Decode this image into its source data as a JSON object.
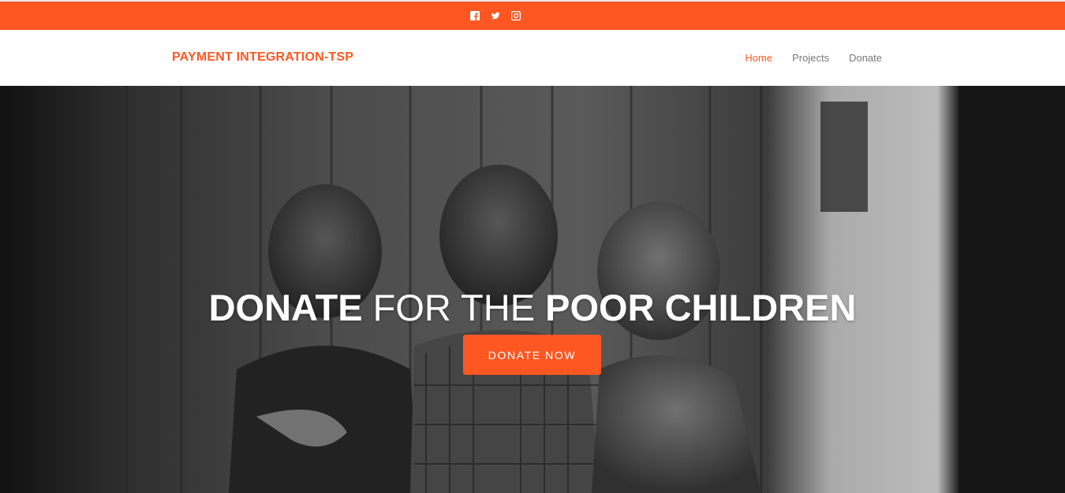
{
  "colors": {
    "accent": "#ff5722",
    "nav_text": "#777777",
    "white": "#ffffff"
  },
  "social_icons": [
    "facebook-icon",
    "twitter-icon",
    "instagram-icon"
  ],
  "header": {
    "brand": "PAYMENT INTEGRATION-TSP",
    "nav": [
      {
        "label": "Home",
        "active": true
      },
      {
        "label": "Projects",
        "active": false
      },
      {
        "label": "Donate",
        "active": false
      }
    ]
  },
  "hero": {
    "headline_part1": "DONATE",
    "headline_part2": " FOR THE ",
    "headline_part3": "POOR CHILDREN",
    "button_label": "DONATE NOW",
    "image": "black-and-white photo of three young children"
  }
}
